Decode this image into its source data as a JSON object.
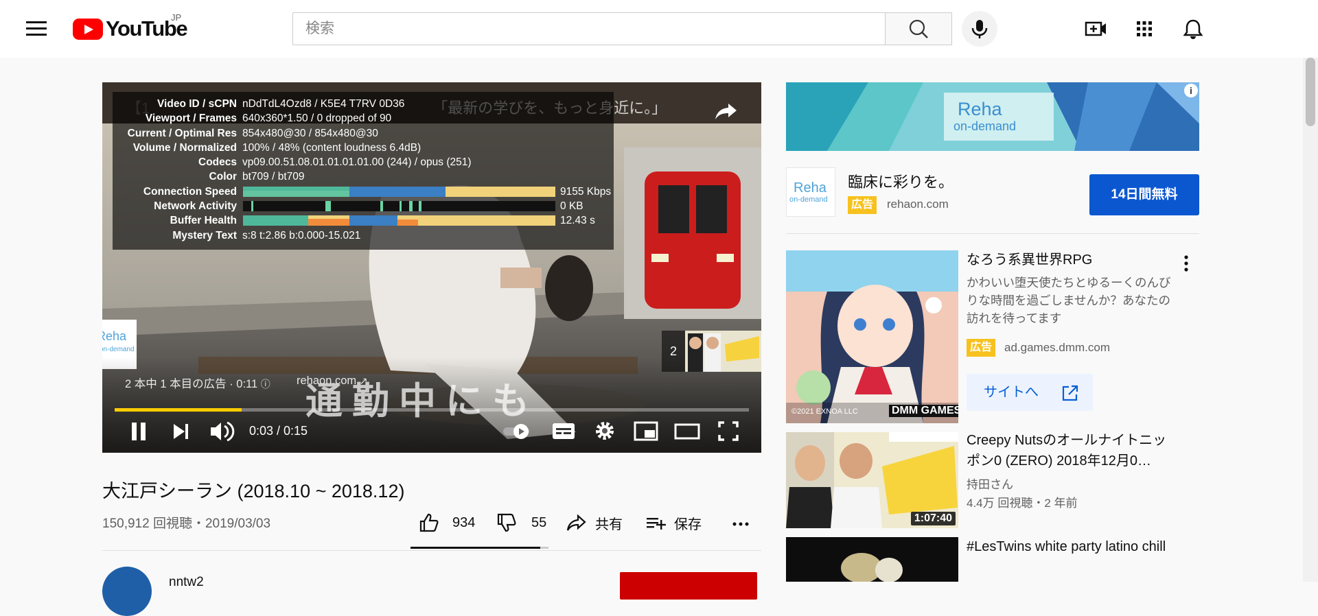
{
  "header": {
    "logo_text": "YouTube",
    "region": "JP",
    "search_placeholder": "検索"
  },
  "player": {
    "title_overlay": "【1",
    "title_overlay_tail": "「最新の学びを、もっと身近に。」",
    "stats": [
      {
        "key": "Video ID / sCPN",
        "value": "nDdTdL4Ozd8 / K5E4 T7RV 0D36"
      },
      {
        "key": "Viewport / Frames",
        "value": "640x360*1.50 / 0 dropped of 90"
      },
      {
        "key": "Current / Optimal Res",
        "value": "854x480@30 / 854x480@30"
      },
      {
        "key": "Volume / Normalized",
        "value": "100% / 48% (content loudness 6.4dB)"
      },
      {
        "key": "Codecs",
        "value": "vp09.00.51.08.01.01.01.01.00 (244) / opus (251)"
      },
      {
        "key": "Color",
        "value": "bt709 / bt709"
      },
      {
        "key": "Connection Speed",
        "value": "9155 Kbps"
      },
      {
        "key": "Network Activity",
        "value": "0 KB"
      },
      {
        "key": "Buffer Health",
        "value": "12.43 s"
      },
      {
        "key": "Mystery Text",
        "value": "s:8 t:2.86 b:0.000-15.021"
      }
    ],
    "ad_info": "2 本中 1 本目の広告 · 0:11",
    "ad_url": "rehaon.com",
    "subtitle": "通勤中にも",
    "next_count": "2",
    "time": "0:03 / 0:15",
    "progress": 0.2,
    "accent_color": "#ffcc00"
  },
  "video": {
    "title": "大江戸シーラン (2018.10 ~ 2018.12)",
    "meta": "150,912 回視聴・2019/03/03",
    "likes": "934",
    "dislikes": "55",
    "share_label": "共有",
    "save_label": "保存",
    "channel_name": "nntw2"
  },
  "sidebar": {
    "banner_text_1": "Reha",
    "banner_text_2": "on-demand",
    "ad_title": "臨床に彩りを。",
    "ad_badge": "広告",
    "ad_domain": "rehaon.com",
    "cta_label": "14日間無料",
    "game_ad": {
      "title": "なろう系異世界RPG",
      "desc": "かわいい堕天使たちとゆるーくのんびりな時間を過ごしませんか？あなたの訪れを待ってます",
      "badge": "広告",
      "domain": "ad.games.dmm.com",
      "button": "サイトへ",
      "copyright": "©2021 EXNOA LLC",
      "brand": "DMM GAMES"
    },
    "videos": [
      {
        "title": "Creepy Nutsのオールナイトニッポン0 (ZERO) 2018年12月0…",
        "channel": "持田さん",
        "meta": "4.4万 回視聴・2 年前",
        "duration": "1:07:40"
      },
      {
        "title": "#LesTwins white party latino chill",
        "channel": "",
        "meta": "",
        "duration": ""
      }
    ]
  }
}
